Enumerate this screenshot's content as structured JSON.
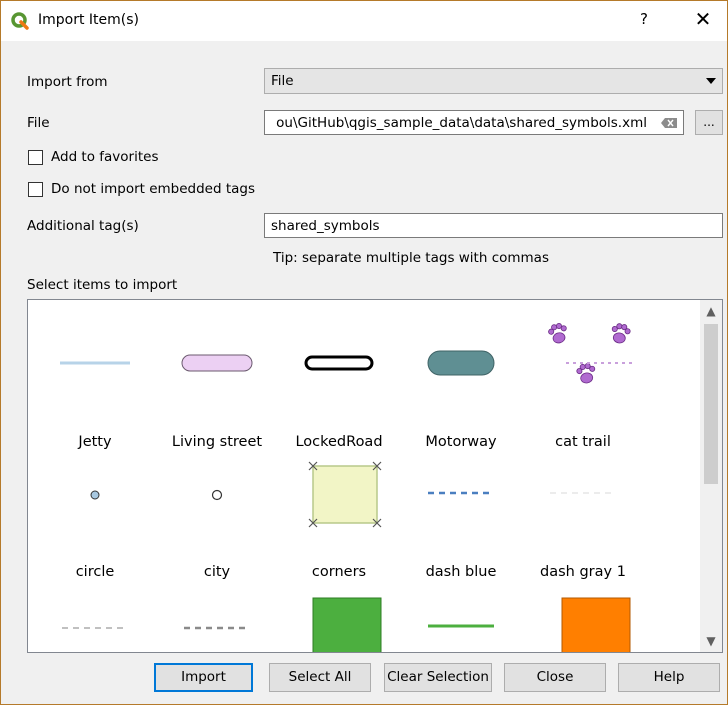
{
  "window": {
    "title": "Import Item(s)",
    "help_glyph": "?",
    "close_glyph": "✕"
  },
  "form": {
    "import_from_label": "Import from",
    "import_from_value": "File",
    "file_label": "File",
    "file_value": "ou\\GitHub\\qgis_sample_data\\data\\shared_symbols.xml",
    "browse_label": "...",
    "add_favorites_label": "Add to favorites",
    "add_favorites_checked": false,
    "no_embedded_tags_label": "Do not import embedded tags",
    "no_embedded_tags_checked": false,
    "additional_tags_label": "Additional tag(s)",
    "additional_tags_value": "shared_symbols",
    "tip": "Tip: separate multiple tags with commas",
    "select_items_label": "Select items to import"
  },
  "items": [
    {
      "name": "Jetty",
      "icon": "thin-light-blue-line"
    },
    {
      "name": "Living street",
      "icon": "light-violet-rounded-bar"
    },
    {
      "name": "LockedRoad",
      "icon": "black-outlined-rounded-line"
    },
    {
      "name": "Motorway",
      "icon": "teal-rounded-bar"
    },
    {
      "name": "cat trail",
      "icon": "purple-paw-prints"
    },
    {
      "name": "circle",
      "icon": "small-blue-circle"
    },
    {
      "name": "city",
      "icon": "small-white-circle"
    },
    {
      "name": "corners",
      "icon": "yellow-square-with-corner-crosses"
    },
    {
      "name": "dash blue",
      "icon": "blue-dashed-line"
    },
    {
      "name": "dash gray 1",
      "icon": "faint-gray-dashed-line"
    },
    {
      "name": "",
      "icon": "light-gray-dashed-line"
    },
    {
      "name": "",
      "icon": "gray-dashed-line"
    },
    {
      "name": "",
      "icon": "green-square"
    },
    {
      "name": "",
      "icon": "green-line"
    },
    {
      "name": "",
      "icon": "orange-square"
    }
  ],
  "buttons": {
    "import": "Import",
    "select_all": "Select All",
    "clear_selection": "Clear Selection",
    "close": "Close",
    "help": "Help"
  },
  "colors": {
    "accent": "#0078d7",
    "qgis_green": "#589632",
    "paw_purple": "#b06ad0"
  }
}
